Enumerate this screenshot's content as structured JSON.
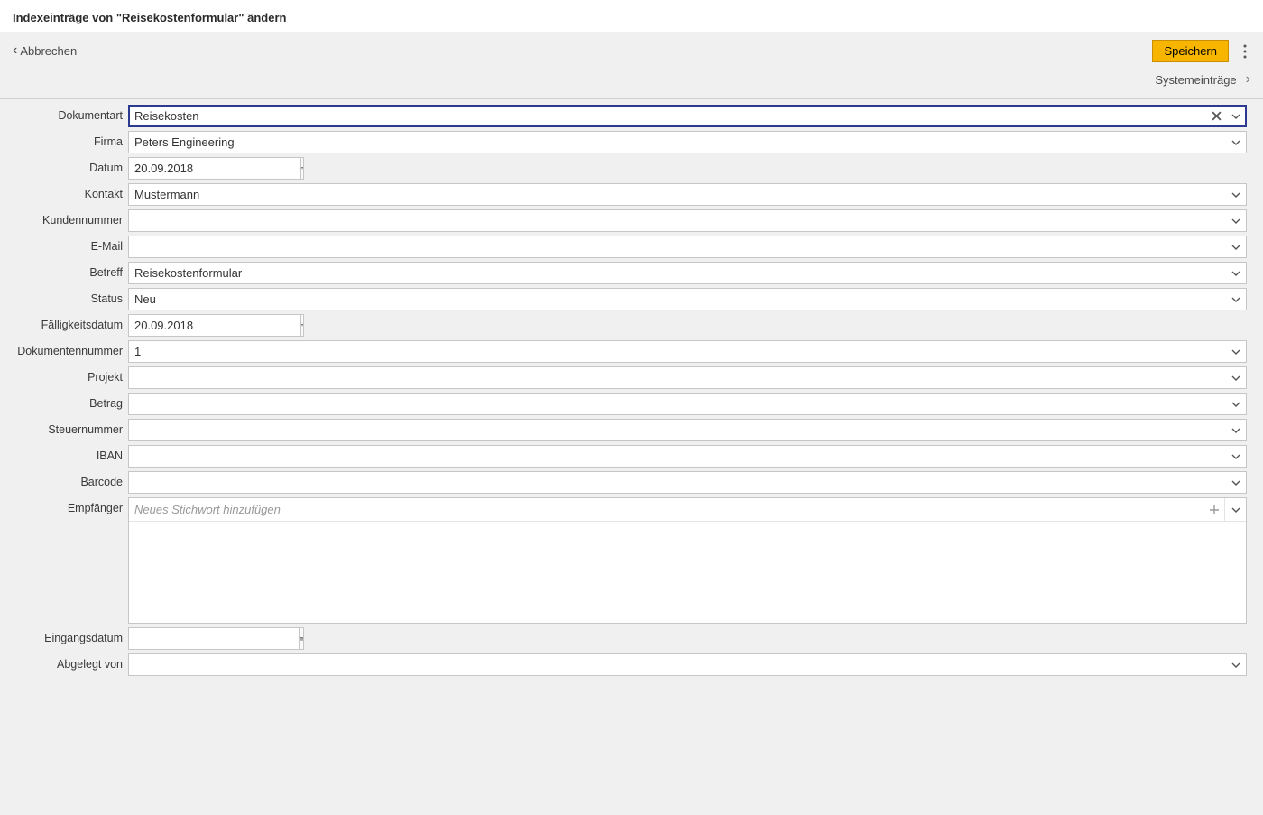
{
  "header": {
    "title": "Indexeinträge von \"Reisekostenformular\" ändern"
  },
  "toolbar": {
    "cancel_label": "Abbrechen",
    "save_label": "Speichern",
    "system_label": "Systemeinträge"
  },
  "form": {
    "fields": [
      {
        "label": "Dokumentart",
        "value": "Reisekosten",
        "type": "combo",
        "active": true,
        "clearable": true
      },
      {
        "label": "Firma",
        "value": "Peters Engineering",
        "type": "combo"
      },
      {
        "label": "Datum",
        "value": "20.09.2018",
        "type": "date"
      },
      {
        "label": "Kontakt",
        "value": "Mustermann",
        "type": "combo"
      },
      {
        "label": "Kundennummer",
        "value": "",
        "type": "combo"
      },
      {
        "label": "E-Mail",
        "value": "",
        "type": "combo"
      },
      {
        "label": "Betreff",
        "value": "Reisekostenformular",
        "type": "combo"
      },
      {
        "label": "Status",
        "value": "Neu",
        "type": "combo"
      },
      {
        "label": "Fälligkeitsdatum",
        "value": "20.09.2018",
        "type": "date"
      },
      {
        "label": "Dokumentennummer",
        "value": "1",
        "type": "combo"
      },
      {
        "label": "Projekt",
        "value": "",
        "type": "combo"
      },
      {
        "label": "Betrag",
        "value": "",
        "type": "combo"
      },
      {
        "label": "Steuernummer",
        "value": "",
        "type": "combo"
      },
      {
        "label": "IBAN",
        "value": "",
        "type": "combo"
      },
      {
        "label": "Barcode",
        "value": "",
        "type": "combo"
      },
      {
        "label": "Empfänger",
        "value": "",
        "type": "keywords",
        "placeholder": "Neues Stichwort hinzufügen"
      },
      {
        "label": "Eingangsdatum",
        "value": "",
        "type": "date_nochev"
      },
      {
        "label": "Abgelegt von",
        "value": "",
        "type": "combo"
      }
    ]
  }
}
